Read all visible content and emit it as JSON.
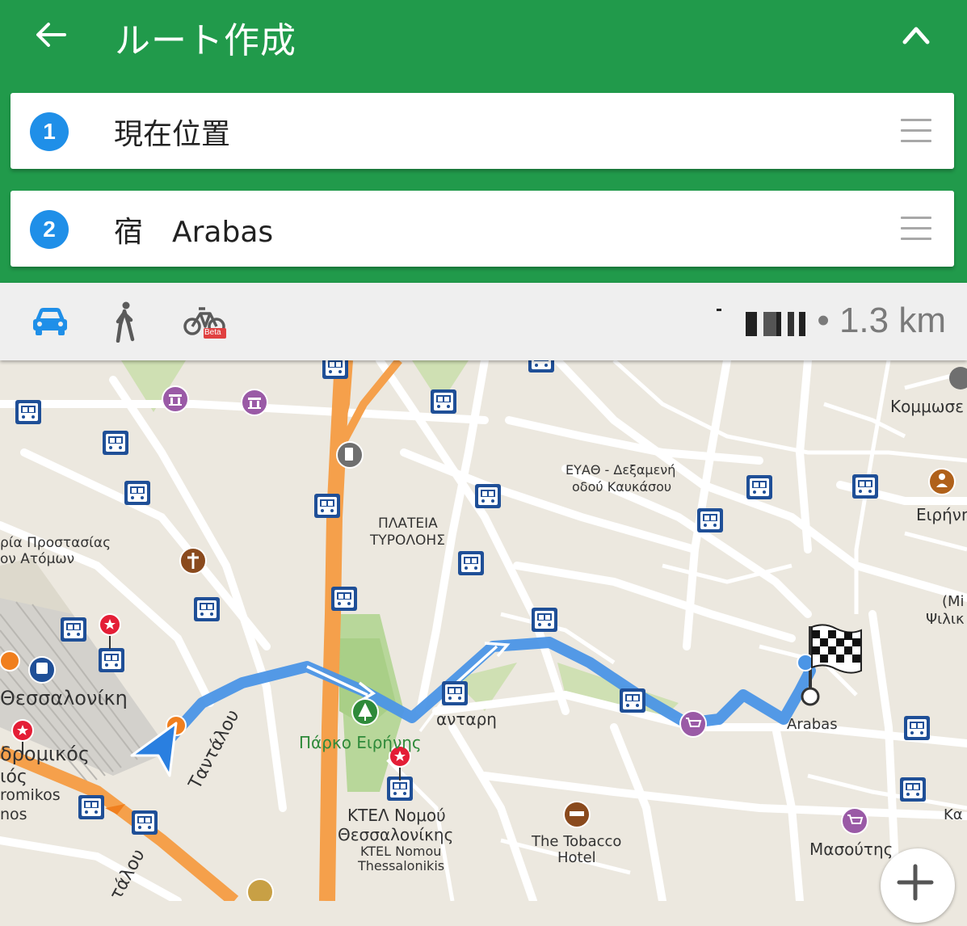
{
  "header": {
    "title": "ルート作成"
  },
  "waypoints": [
    {
      "number": "1",
      "label": "現在位置"
    },
    {
      "number": "2",
      "label": "宿　Arabas"
    }
  ],
  "modes": {
    "bike_badge": "Beta"
  },
  "summary": {
    "distance": "• 1.3 km"
  },
  "map_labels": {
    "kommose": "Κομμωσε",
    "eyath": "ΕΥΑΘ - Δεξαμενή",
    "kafkasou": "οδού Καυκάσου",
    "plateia": "ΠΛΑΤΕΙΑ",
    "tyrolois": "ΤΥΡΟΛΟΗΣ",
    "prostasias": "ρία Προστασίας",
    "atomon": "ον Ατόμων",
    "eirini": "Ειρήνη",
    "mi": "(Mi",
    "psili": "Ψιλικ",
    "thessaloniki": "Θεσσαλονίκη",
    "dromikos": "δρομικός",
    "os": "ιός",
    "romikos": "romikos",
    "nos": "nos",
    "tantalou": "Ταντάλου",
    "tantalou2": "τάλου",
    "park": "Πάρκο Ειρήνης",
    "kanantarh": "ανταρη",
    "ktel1": "ΚΤΕΛ Νομού",
    "ktel2": "Θεσσαλονίκης",
    "ktel3": "KTEL Nomou",
    "ktel4": "Thessalonikis",
    "tobacco1": "The Tobacco",
    "tobacco2": "Hotel",
    "arabas": "Arabas",
    "masoutis": "Μασούτης",
    "ka": "Κα"
  },
  "colors": {
    "header": "#219a4b",
    "accent": "#1f8fe8",
    "route": "#4b95e6",
    "highway": "#f5a04b"
  }
}
